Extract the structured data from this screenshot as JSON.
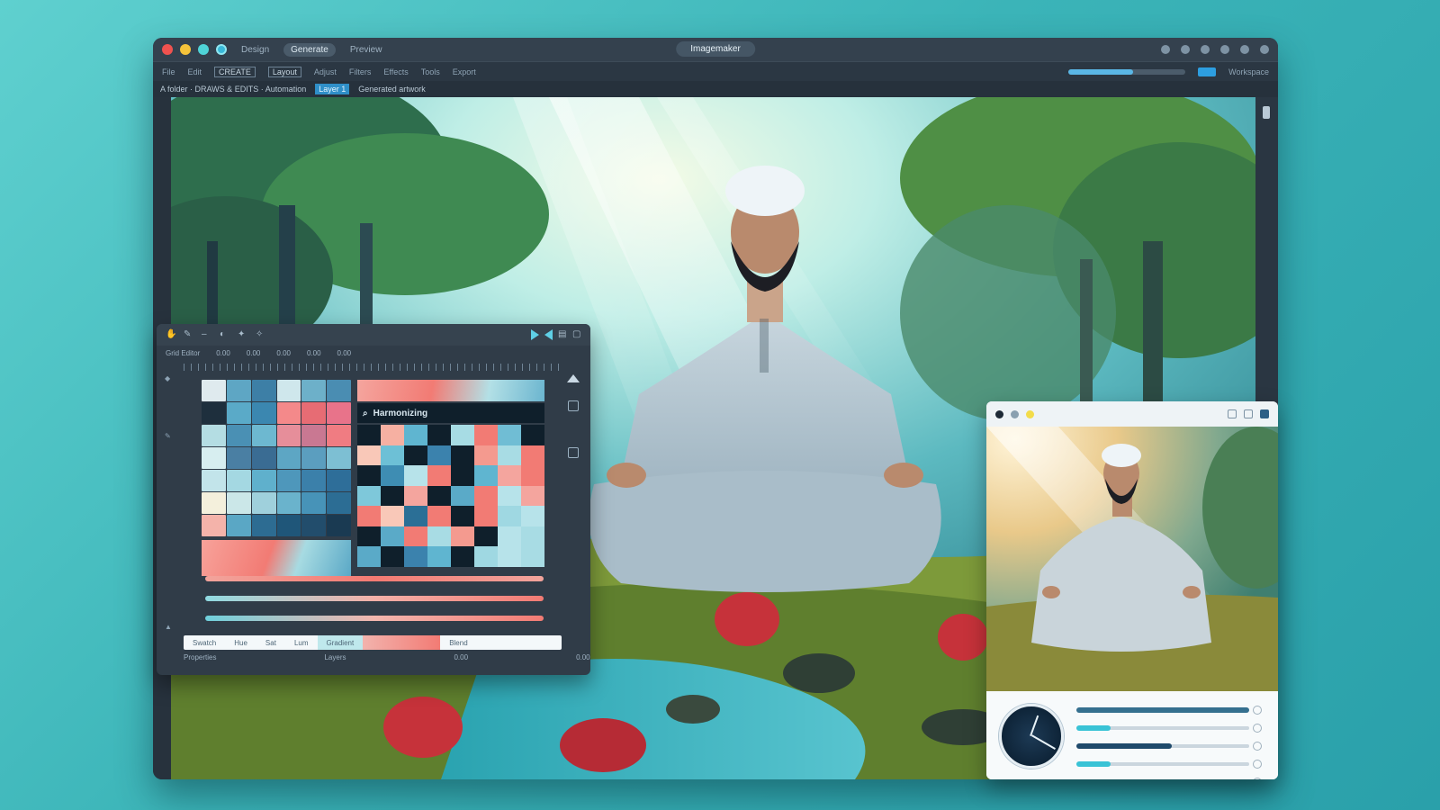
{
  "window": {
    "title": "Imagemaker",
    "menu": [
      {
        "label": "Design"
      },
      {
        "label": "Generate",
        "active": true
      },
      {
        "label": "Preview"
      }
    ]
  },
  "toolbar": {
    "items": [
      "File",
      "Edit",
      "CREATE",
      "Layout",
      "Adjust",
      "Filters",
      "Effects",
      "Tools",
      "Export"
    ],
    "progress": 0.55,
    "right_label": "Workspace"
  },
  "breadcrumb": {
    "items": [
      {
        "label": "A folder · DRAWS & EDITS · Automation"
      },
      {
        "label": "Layer 1",
        "active": true
      },
      {
        "label": "Generated artwork"
      }
    ]
  },
  "editor_panel": {
    "sub_labels": [
      "Grid Editor",
      "0.00",
      "0.00",
      "0.00",
      "0.00",
      "0.00"
    ],
    "heading": "Harmonizing",
    "tabs": [
      {
        "label": "Swatch"
      },
      {
        "label": "Hue"
      },
      {
        "label": "Sat"
      },
      {
        "label": "Lum"
      },
      {
        "label": "Gradient",
        "sel": true
      },
      {
        "label": "",
        "grad": true
      },
      {
        "label": "Blend"
      }
    ],
    "footer": [
      "Properties",
      "Layers",
      "0.00",
      "0.00"
    ],
    "sliders": [
      {
        "colors": [
          "#f2a49c",
          "#f37a72",
          "#f2a49c"
        ]
      },
      {
        "colors": [
          "#8fdbe2",
          "#f4b0a8",
          "#f27b74"
        ]
      },
      {
        "colors": [
          "#6fd0dc",
          "#f2b6ae",
          "#f27b74"
        ]
      }
    ],
    "palette_left": [
      "#dfeaee",
      "#5ea6c4",
      "#3d7fa6",
      "#cfe7ec",
      "#6db0c9",
      "#4a8db2",
      "#1e2f3d",
      "#5aaac8",
      "#3b87b0",
      "#f4898a",
      "#e76c74",
      "#e8738a",
      "#b4dde3",
      "#4a90b4",
      "#6db8d0",
      "#e68e9a",
      "#c97892",
      "#f07c82",
      "#d7eef0",
      "#4a7fa3",
      "#3a6c93",
      "#5da6c4",
      "#5b9ebf",
      "#7dbfd3",
      "#c2e4ea",
      "#a4d8e2",
      "#5fb0cc",
      "#4e97bb",
      "#3b80aa",
      "#2e6e99",
      "#f4f0dc",
      "#cbe7e8",
      "#9fd0dc",
      "#6ab3cc",
      "#4793b8",
      "#2c6d94",
      "#f4b3aa",
      "#5aa7c5",
      "#2d6c92",
      "#1f5679",
      "#224d6c",
      "#1a3a52"
    ],
    "palette_right": [
      "#0f1f2b",
      "#f6b0a2",
      "#5fb5d0",
      "#0f1f2b",
      "#a7dce4",
      "#f27b74",
      "#70bdd4",
      "#0f1f2b",
      "#f9c8b8",
      "#6dc0d6",
      "#0f1f2b",
      "#3b82ad",
      "#0f1f2b",
      "#f49a8f",
      "#a8dce4",
      "#f27b74",
      "#0f1f2b",
      "#3e8db3",
      "#b7e3ea",
      "#f27b74",
      "#0f1f2b",
      "#5fb5d0",
      "#f4a59e",
      "#f27b74",
      "#7ec8da",
      "#0f1f2b",
      "#f4a59e",
      "#0f1f2b",
      "#5aaac8",
      "#f27b74",
      "#b7e3ea",
      "#f4a59e",
      "#f27b74",
      "#f9c8b8",
      "#2b6f96",
      "#f27b74",
      "#0f1f2b",
      "#f27b74",
      "#9fd8e2",
      "#b7e3ea",
      "#0f1f2b",
      "#5aaac8",
      "#f27b74",
      "#a8dce4",
      "#f49a8f",
      "#0f1f2b",
      "#b7e3ea",
      "#a8dce4",
      "#5aaac8",
      "#0f1f2b",
      "#3b82ad",
      "#5fb5d0",
      "#0f1f2b",
      "#9fd8e2",
      "#b7e3ea",
      "#a8dce4"
    ]
  },
  "preview": {
    "sliders": [
      {
        "color": "#35708f",
        "value": 1.0
      },
      {
        "color": "#39c3d6",
        "value": 0.2
      },
      {
        "color": "#1f4a6b",
        "value": 0.55
      },
      {
        "color": "#39c3d6",
        "value": 0.2
      },
      {
        "color": "#f27b74",
        "value": 1.0,
        "gradient": true
      }
    ]
  }
}
